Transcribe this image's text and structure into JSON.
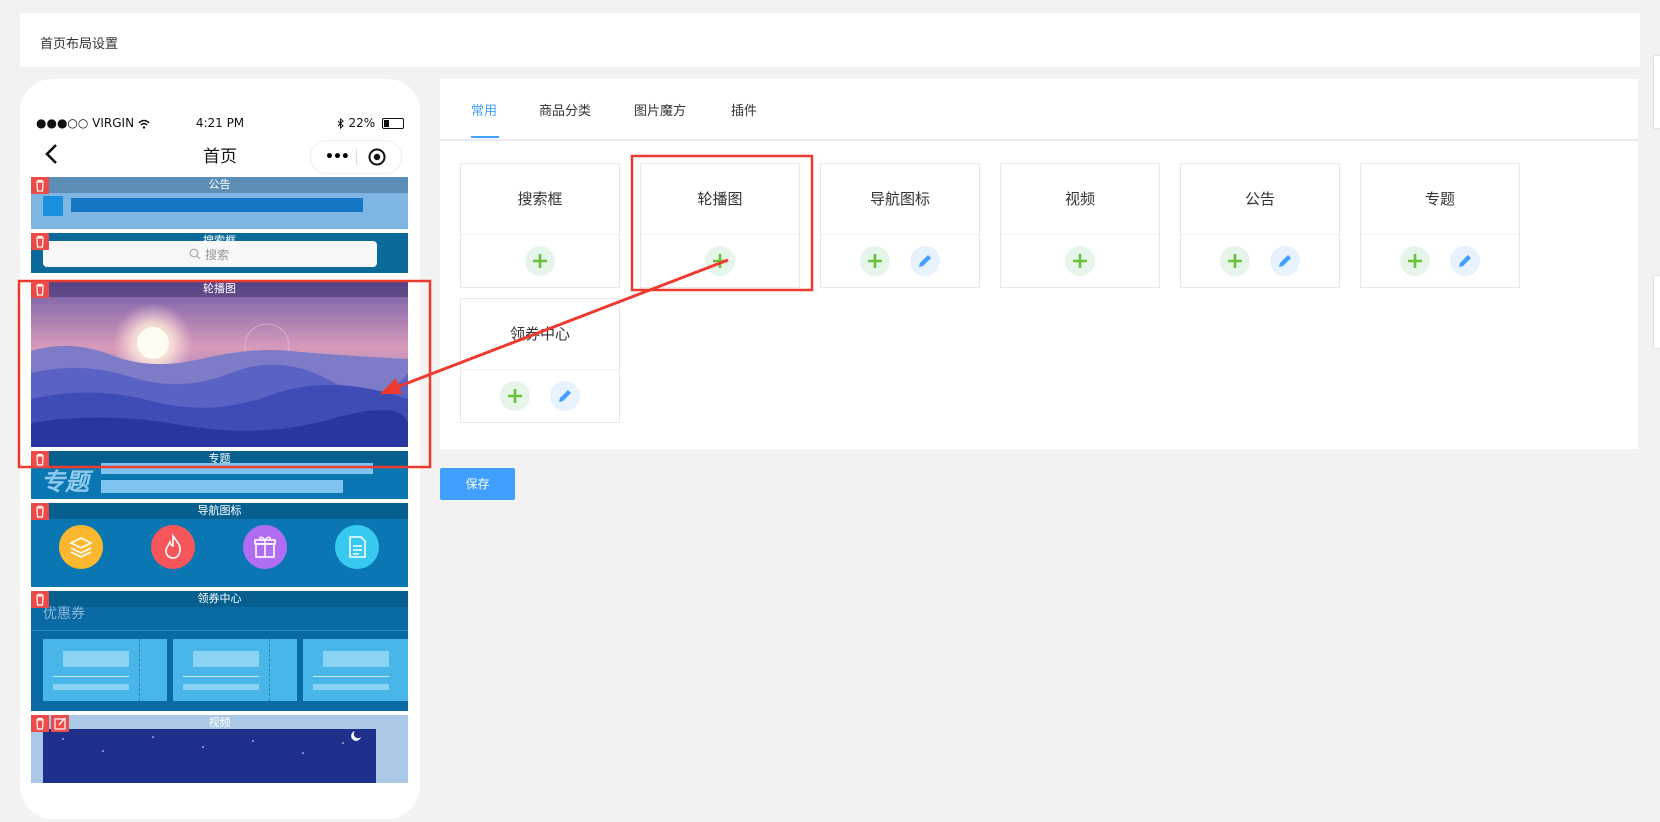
{
  "page": {
    "title": "首页布局设置"
  },
  "phone": {
    "status": {
      "carrier": "●●●○○ VIRGIN",
      "time": "4:21 PM",
      "battery": "22%"
    },
    "nav_title": "首页",
    "capsule_more": "•••",
    "modules": {
      "notice": "公告",
      "search": "搜索框",
      "search_placeholder": "搜索",
      "banner": "轮播图",
      "topic": "专题",
      "topic_logo": "专题",
      "nav_icons": "导航图标",
      "coupon": "领券中心",
      "coupon_text": "优惠券",
      "video": "视频"
    }
  },
  "tabs": [
    {
      "label": "常用"
    },
    {
      "label": "商品分类"
    },
    {
      "label": "图片魔方"
    },
    {
      "label": "插件"
    }
  ],
  "components": [
    {
      "name": "搜索框",
      "actions": [
        "add"
      ]
    },
    {
      "name": "轮播图",
      "actions": [
        "add"
      ]
    },
    {
      "name": "导航图标",
      "actions": [
        "add",
        "edit"
      ]
    },
    {
      "name": "视频",
      "actions": [
        "add"
      ]
    },
    {
      "name": "公告",
      "actions": [
        "add",
        "edit"
      ]
    },
    {
      "name": "专题",
      "actions": [
        "add",
        "edit"
      ]
    },
    {
      "name": "领券中心",
      "actions": [
        "add",
        "edit"
      ]
    }
  ],
  "save_label": "保存",
  "colors": {
    "accent": "#409eff",
    "highlight": "#ec3a2f",
    "add": "#67c23a"
  }
}
